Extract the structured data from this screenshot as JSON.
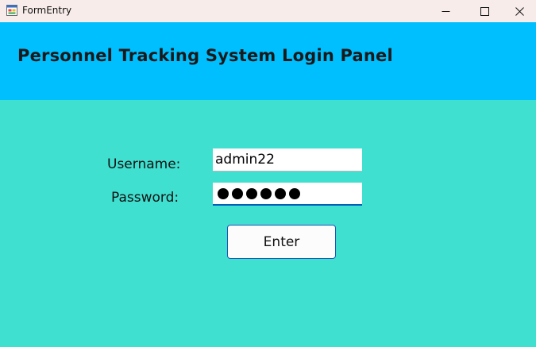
{
  "window": {
    "title": "FormEntry",
    "icon": "form-app-icon",
    "controls": {
      "minimize_icon": "minimize-icon",
      "maximize_icon": "maximize-icon",
      "close_icon": "close-icon"
    }
  },
  "header": {
    "title": "Personnel Tracking System Login Panel"
  },
  "form": {
    "username_label": "Username:",
    "username_value": "admin22",
    "password_label": "Password:",
    "password_masked_length": 6,
    "enter_label": "Enter"
  },
  "colors": {
    "background": "#40e0d0",
    "header_background": "#00bfff",
    "titlebar_background": "#f7ecea",
    "focus_accent": "#005fb8"
  }
}
